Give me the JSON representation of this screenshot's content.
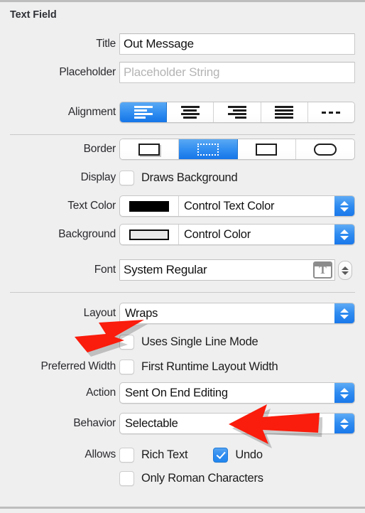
{
  "panel": {
    "section_title": "Text Field"
  },
  "rows": {
    "title": {
      "label": "Title",
      "value": "Out Message"
    },
    "placeholder": {
      "label": "Placeholder",
      "placeholder": "Placeholder String"
    },
    "alignment": {
      "label": "Alignment",
      "segments": [
        {
          "name": "align-left",
          "selected": true
        },
        {
          "name": "align-center",
          "selected": false
        },
        {
          "name": "align-right",
          "selected": false
        },
        {
          "name": "align-justified",
          "selected": false
        },
        {
          "name": "align-natural",
          "selected": false
        }
      ]
    },
    "border": {
      "label": "Border",
      "segments": [
        {
          "name": "border-bezel",
          "selected": false
        },
        {
          "name": "border-none-dotted",
          "selected": true
        },
        {
          "name": "border-line",
          "selected": false
        },
        {
          "name": "border-rounded",
          "selected": false
        }
      ]
    },
    "display": {
      "label": "Display",
      "checkbox_label": "Draws Background",
      "checked": false
    },
    "text_color": {
      "label": "Text Color",
      "value": "Control Text Color",
      "swatch": "#000000"
    },
    "background": {
      "label": "Background",
      "value": "Control Color",
      "swatch": "#e8e8e8"
    },
    "font": {
      "label": "Font",
      "value": "System Regular",
      "icon": "font-panel-icon"
    },
    "layout": {
      "label": "Layout",
      "value": "Wraps"
    },
    "single_line": {
      "checkbox_label": "Uses Single Line Mode",
      "checked": false
    },
    "preferred_width": {
      "label": "Preferred Width",
      "checkbox_label": "First Runtime Layout Width",
      "checked": false
    },
    "action": {
      "label": "Action",
      "value": "Sent On End Editing"
    },
    "behavior": {
      "label": "Behavior",
      "value": "Selectable"
    },
    "allows": {
      "label": "Allows",
      "rich_text": {
        "checkbox_label": "Rich Text",
        "checked": false
      },
      "undo": {
        "checkbox_label": "Undo",
        "checked": true
      },
      "only_roman": {
        "checkbox_label": "Only Roman Characters",
        "checked": false
      }
    }
  },
  "annotations": {
    "arrow_color": "#fa1c0c",
    "arrow_layout": "points at Layout popup button",
    "arrow_behavior": "points at Behavior popup button"
  },
  "colors": {
    "panel_background": "#efeff0",
    "accent_blue": "#2e8bf0",
    "selected_segment_blue": "#1675e8",
    "label_text": "#2a2a2e",
    "divider": "#c9c9ca"
  }
}
